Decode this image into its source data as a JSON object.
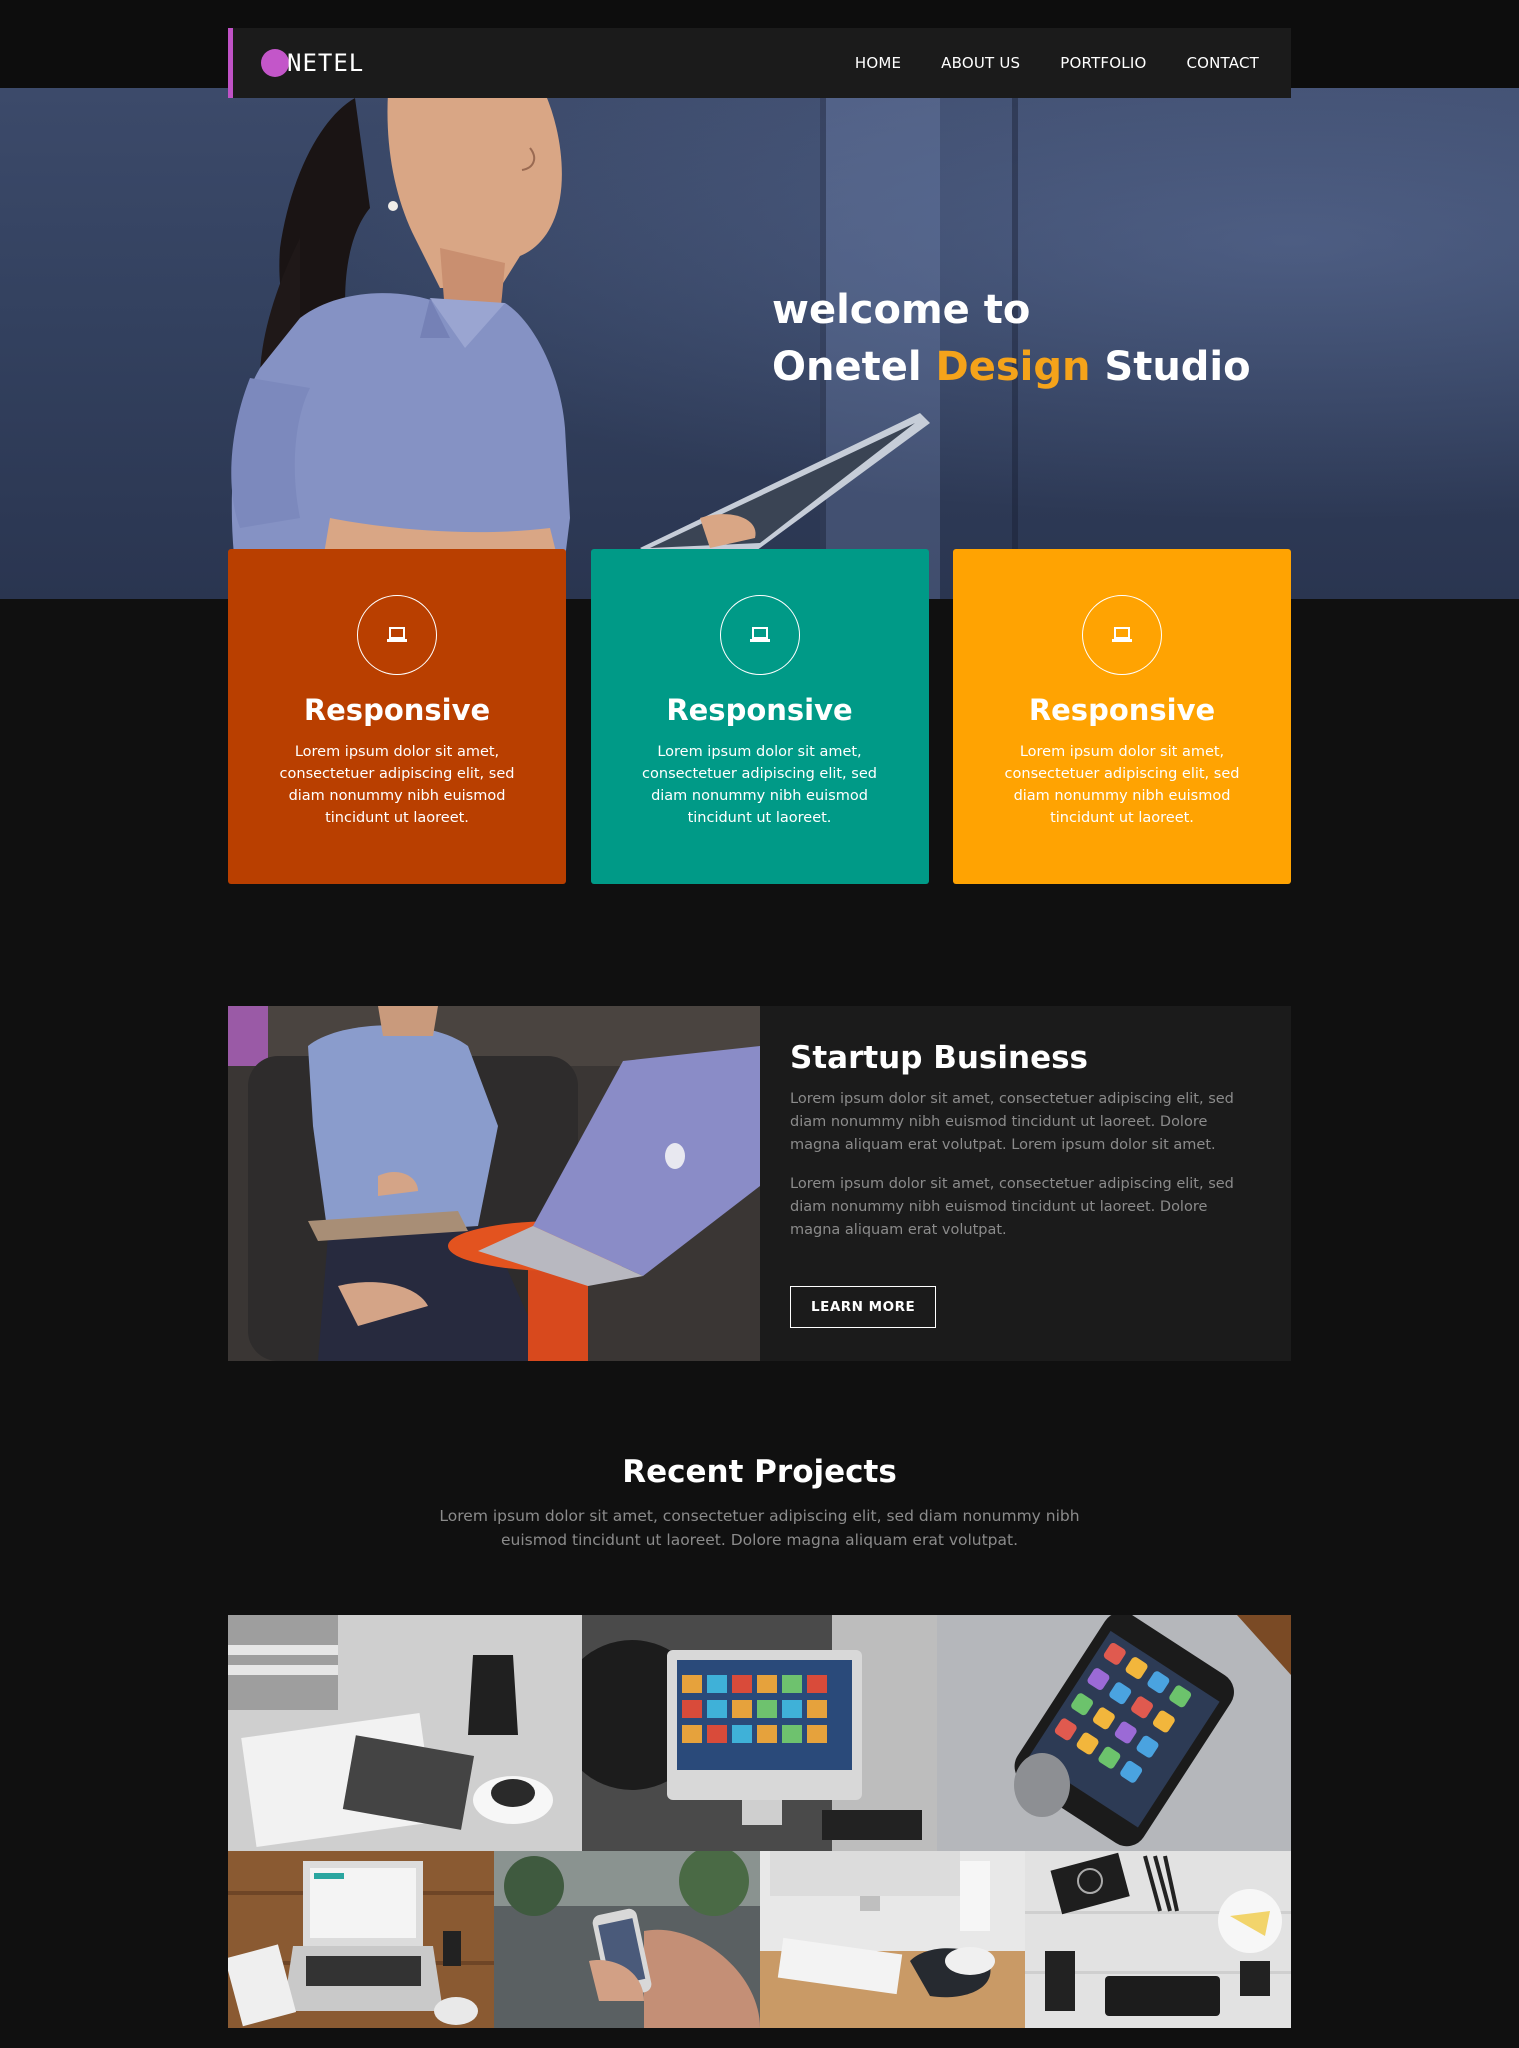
{
  "nav": {
    "logo_text": "NETEL",
    "items": [
      {
        "label": "HOME"
      },
      {
        "label": "ABOUT US"
      },
      {
        "label": "PORTFOLIO"
      },
      {
        "label": "CONTACT"
      }
    ]
  },
  "hero": {
    "line1": "welcome to",
    "line2_a": "Onetel ",
    "line2_accent": "Design",
    "line2_b": " Studio"
  },
  "cards": [
    {
      "title": "Responsive",
      "text": "Lorem ipsum dolor sit amet, consectetuer adipiscing elit, sed diam nonummy nibh euismod tincidunt ut laoreet.",
      "icon": "laptop-icon",
      "color": "#b93f00"
    },
    {
      "title": "Responsive",
      "text": "Lorem ipsum dolor sit amet, consectetuer adipiscing elit, sed diam nonummy nibh euismod tincidunt ut laoreet.",
      "icon": "laptop-icon",
      "color": "#009a87"
    },
    {
      "title": "Responsive",
      "text": "Lorem ipsum dolor sit amet, consectetuer adipiscing elit, sed diam nonummy nibh euismod tincidunt ut laoreet.",
      "icon": "laptop-icon",
      "color": "#ffa302"
    }
  ],
  "startup": {
    "title": "Startup Business",
    "para1": "Lorem ipsum dolor sit amet, consectetuer adipiscing elit, sed diam nonummy nibh euismod tincidunt ut laoreet. Dolore magna aliquam erat volutpat. Lorem ipsum dolor sit amet.",
    "para2": "Lorem ipsum dolor sit amet, consectetuer adipiscing elit, sed diam nonummy nibh euismod tincidunt ut laoreet. Dolore magna aliquam erat volutpat.",
    "button": "LEARN MORE"
  },
  "recent": {
    "title": "Recent Projects",
    "subtitle": "Lorem ipsum dolor sit amet, consectetuer adipiscing elit, sed diam nonummy nibh euismod tincidunt ut laoreet. Dolore magna aliquam erat volutpat."
  },
  "colors": {
    "accent": "#f5a31a",
    "brand": "#c356c9",
    "background": "#101010"
  }
}
